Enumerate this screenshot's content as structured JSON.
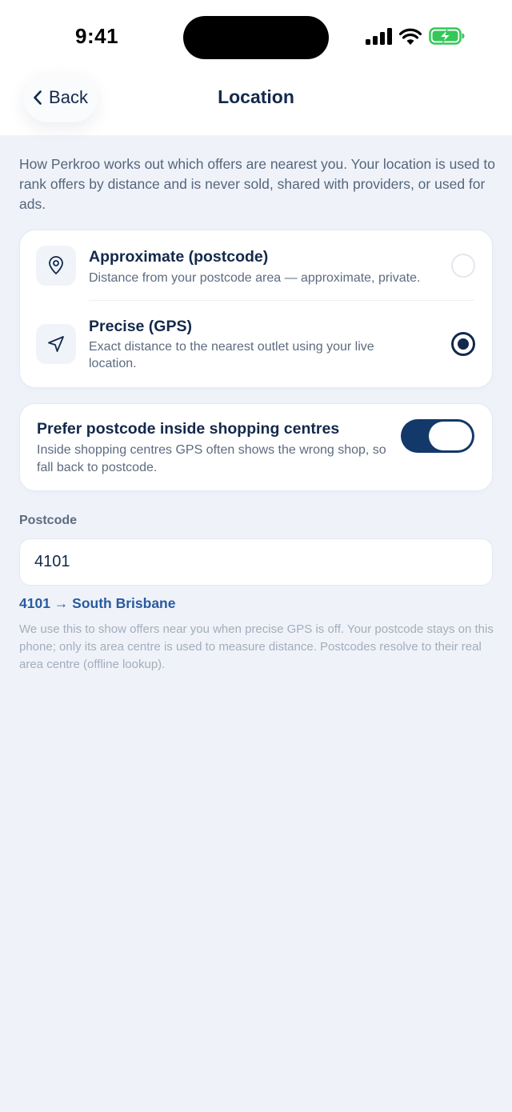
{
  "status_bar": {
    "time": "9:41"
  },
  "nav": {
    "back_label": "Back",
    "title": "Location"
  },
  "intro": "How Perkroo works out which offers are nearest you. Your location is used to rank offers by distance and is never sold, shared with providers, or used for ads.",
  "modes": [
    {
      "title": "Approximate (postcode)",
      "description": "Distance from your postcode area — approximate, private.",
      "icon": "map-pin-icon",
      "selected": false
    },
    {
      "title": "Precise (GPS)",
      "description": "Exact distance to the nearest outlet using your live location.",
      "icon": "navigation-arrow-icon",
      "selected": true
    }
  ],
  "prefer_postcode": {
    "title": "Prefer postcode inside shopping centres",
    "description": "Inside shopping centres GPS often shows the wrong shop, so fall back to postcode.",
    "enabled": true
  },
  "postcode": {
    "label": "Postcode",
    "value": "4101",
    "resolved": "4101 → South Brisbane",
    "help": "We use this to show offers near you when precise GPS is off. Your postcode stays on this phone; only its area centre is used to measure distance. Postcodes resolve to their real area centre (offline lookup)."
  },
  "colors": {
    "primary": "#13294b",
    "accent": "#2a5aa0",
    "background": "#eff3f9",
    "battery": "#34c759"
  }
}
